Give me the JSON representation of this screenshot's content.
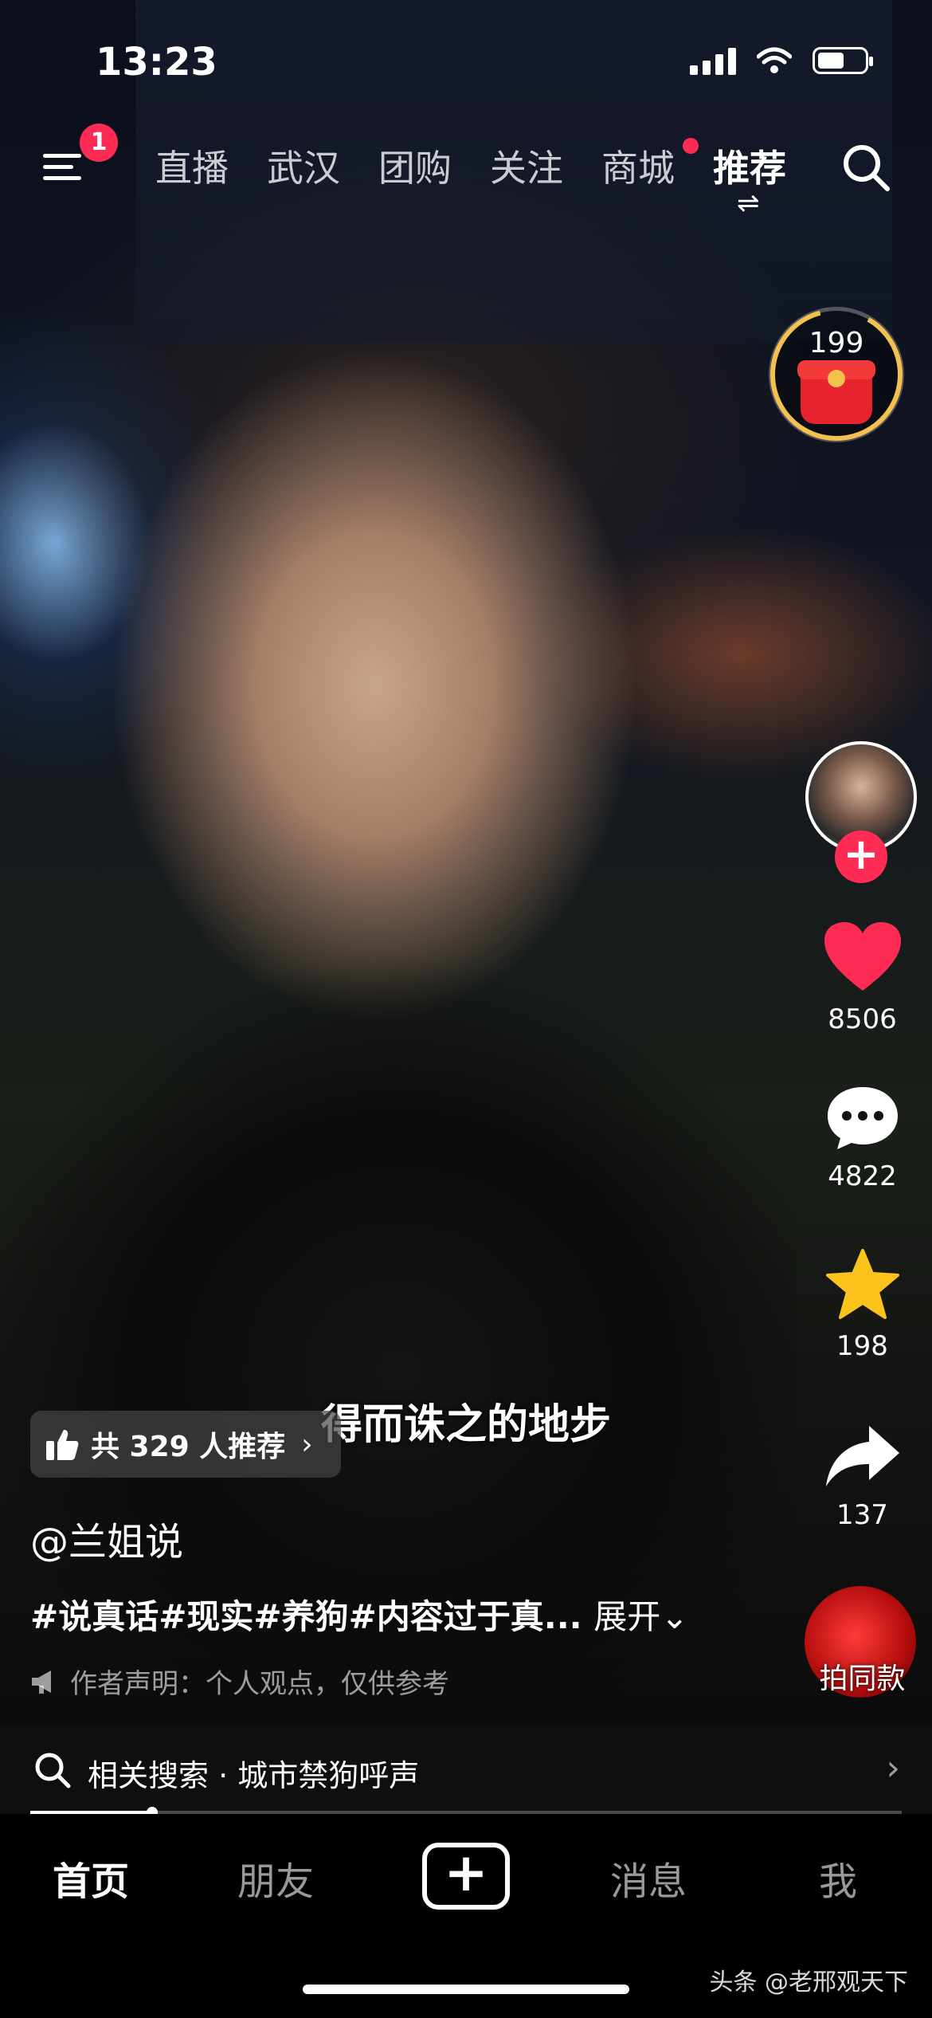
{
  "status": {
    "time": "13:23"
  },
  "top_nav": {
    "notification_count": "1",
    "tabs": [
      "直播",
      "武汉",
      "团购",
      "关注",
      "商城",
      "推荐"
    ],
    "active_tab": "推荐"
  },
  "red_packet": {
    "count": "199"
  },
  "video": {
    "subtitle": "得而诛之的地步"
  },
  "actions": {
    "likes": "8506",
    "comments": "4822",
    "favorites": "198",
    "shares": "137"
  },
  "recommend": {
    "text": "共 329 人推荐"
  },
  "post": {
    "author": "@兰姐说",
    "description": "#说真话#现实#养狗#内容过于真...",
    "expand": "展开",
    "notice": "作者声明：个人观点，仅供参考"
  },
  "same_style": {
    "label": "拍同款"
  },
  "related_search": {
    "text": "相关搜索 · 城市禁狗呼声"
  },
  "progress": {
    "fraction": 0.14
  },
  "tab_bar": {
    "home": "首页",
    "friends": "朋友",
    "messages": "消息",
    "me": "我"
  },
  "watermark": "头条 @老邢观天下",
  "colors": {
    "accent": "#fe2c55",
    "star": "#fcc31c"
  },
  "icons": [
    "menu-icon",
    "search-icon",
    "swap-icon",
    "heart-icon",
    "comment-icon",
    "star-icon",
    "share-icon",
    "thumbs-up-icon",
    "megaphone-icon",
    "plus-icon"
  ]
}
